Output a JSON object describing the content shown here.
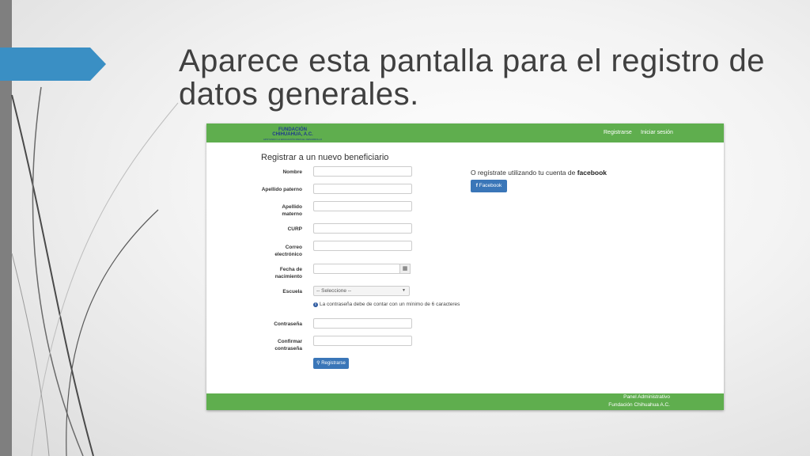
{
  "slide": {
    "title_line1": "Aparece esta pantalla para el registro de",
    "title_line2": "datos generales."
  },
  "colors": {
    "accent_blue": "#3a8fc4",
    "navbar_green": "#5fae4e",
    "button_blue": "#3a76b8",
    "left_bar": "#7f7f7f"
  },
  "app": {
    "logo": {
      "line1": "FUNDACIÓN",
      "line2": "CHIHUAHUA, A.C.",
      "line3": "APOYANDO LA EDUCACIÓN PARA EL DESARROLLO"
    },
    "nav": {
      "register": "Registrarse",
      "login": "Iniciar sesión"
    },
    "form": {
      "title": "Registrar a un nuevo beneficiario",
      "labels": {
        "nombre": "Nombre",
        "apellido_paterno": "Apellido paterno",
        "apellido_materno_1": "Apellido",
        "apellido_materno_2": "materno",
        "curp": "CURP",
        "correo_1": "Correo",
        "correo_2": "electrónico",
        "fecha_1": "Fecha de",
        "fecha_2": "nacimiento",
        "escuela": "Escuela",
        "contrasena": "Contraseña",
        "confirmar_1": "Confirmar",
        "confirmar_2": "contraseña"
      },
      "values": {
        "nombre": "",
        "apellido_paterno": "",
        "apellido_materno": "",
        "curp": "",
        "correo": "",
        "fecha": "",
        "contrasena": "",
        "confirmar": ""
      },
      "escuela_selected": "-- Seleccione --",
      "password_hint": "La contraseña debe de contar con un mínimo de 6 caracteres",
      "submit_label": "Registrarse",
      "submit_icon": "key-icon",
      "calendar_icon": "calendar-icon"
    },
    "facebook": {
      "prompt": "O regístrate utilizando tu cuenta de",
      "brand": "facebook",
      "button_label": "Facebook"
    },
    "footer": {
      "line1": "Panel Administrativo",
      "line2": "Fundación Chihuahua A.C."
    }
  }
}
